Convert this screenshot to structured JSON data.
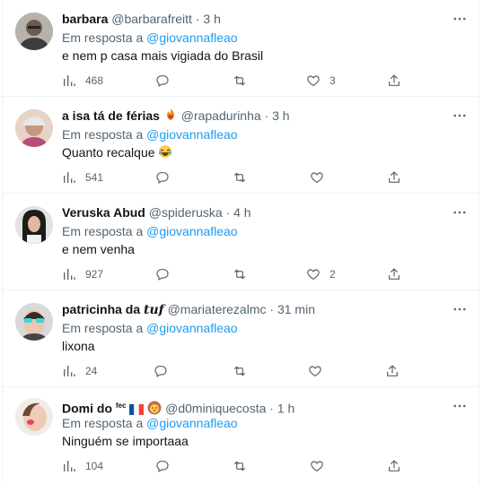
{
  "tweets": [
    {
      "name": "barbara",
      "handle": "@barbarafreitt",
      "dot": "·",
      "time": "3 h",
      "reply_prefix": "Em resposta a",
      "reply_to": "@giovannafleao",
      "text": "e nem p casa mais vigiada do Brasil",
      "views": "468",
      "likes": "3"
    },
    {
      "name": "a isa tá de férias",
      "handle": "@rapadurinha",
      "dot": "·",
      "time": "3 h",
      "reply_prefix": "Em resposta a",
      "reply_to": "@giovannafleao",
      "text": "Quanto recalque",
      "views": "541",
      "likes": ""
    },
    {
      "name": "Veruska Abud",
      "handle": "@spideruska",
      "dot": "·",
      "time": "4 h",
      "reply_prefix": "Em resposta a",
      "reply_to": "@giovannafleao",
      "text": "e nem venha",
      "views": "927",
      "likes": "2"
    },
    {
      "name": "patricinha da ",
      "name_suffix": "tuf",
      "handle": "@mariaterezalmc",
      "dot": "·",
      "time": "31 min",
      "reply_prefix": "Em resposta a",
      "reply_to": "@giovannafleao",
      "text": "lixona",
      "views": "24",
      "likes": ""
    },
    {
      "name": "Domi do",
      "name_suffix": "fec",
      "handle": "@d0miniquecosta",
      "dot": "·",
      "time": "1 h",
      "reply_prefix": "Em resposta a",
      "reply_to": "@giovannafleao",
      "text": "Ninguém se importaaa",
      "views": "104",
      "likes": ""
    }
  ],
  "colors": {
    "accent": "#1d9bf0",
    "muted": "#536471",
    "text": "#0f1419",
    "divider": "#eff3f4"
  }
}
